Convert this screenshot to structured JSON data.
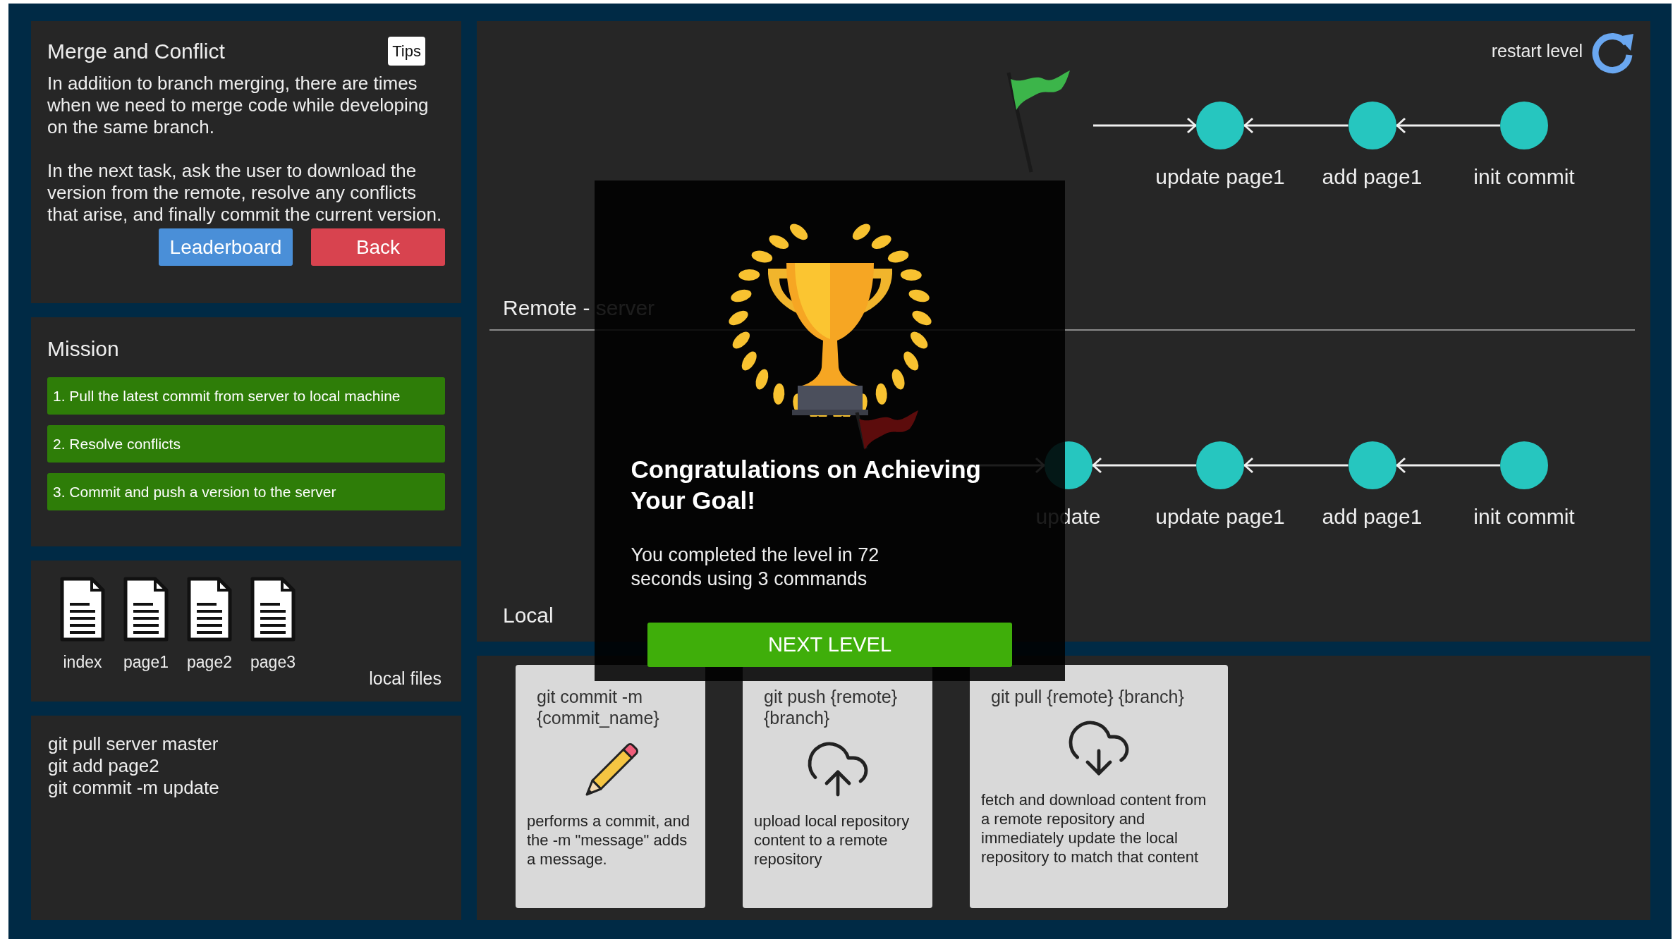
{
  "lesson": {
    "title": "Merge and Conflict",
    "tips_button": "Tips",
    "paragraphs": [
      "In addition to branch merging, there are times when we need to merge code while developing on the same branch.",
      "In the next task, ask the user to download the version from the remote, resolve any conflicts that arise, and finally commit the current version."
    ],
    "buttons": [
      {
        "label": "Leaderboard",
        "kind": "primary"
      },
      {
        "label": "Back",
        "kind": "danger"
      }
    ]
  },
  "mission": {
    "title": "Mission",
    "tasks": [
      {
        "text": "1. Pull the latest commit from server to local machine",
        "done": true
      },
      {
        "text": "2. Resolve conflicts",
        "done": true
      },
      {
        "text": "3. Commit and push a version to the server",
        "done": true
      }
    ]
  },
  "local_files": {
    "files": [
      "index",
      "page1",
      "page2",
      "page3"
    ],
    "label": "local files"
  },
  "command_log": [
    "git pull server master",
    "git add page2",
    "git commit -m update"
  ],
  "restart_label": "restart level",
  "remote": {
    "label": "Remote - server",
    "flag": {
      "color": "#3cb54a"
    },
    "commits": [
      "update page1",
      "add page1",
      "init commit"
    ]
  },
  "local": {
    "label": "Local",
    "flag": {
      "color": "#5c0c0c"
    },
    "commits": [
      "update",
      "update page1",
      "add page1",
      "init commit"
    ]
  },
  "command_cards": [
    {
      "kind": "commit",
      "command": "git commit -m {commit_name}",
      "description": "performs a commit, and the -m \"message\" adds a message."
    },
    {
      "kind": "push",
      "command": "git push {remote} {branch}",
      "description": "upload local repository content to a remote repository"
    },
    {
      "kind": "pull",
      "command": "git pull {remote} {branch}",
      "description": "fetch and download content from a remote repository and immediately update the local repository to match that content"
    }
  ],
  "dialog": {
    "title": "Congratulations on Achieving Your Goal!",
    "message": "You completed the level in 72 seconds using 3 commands",
    "button": "NEXT LEVEL"
  }
}
